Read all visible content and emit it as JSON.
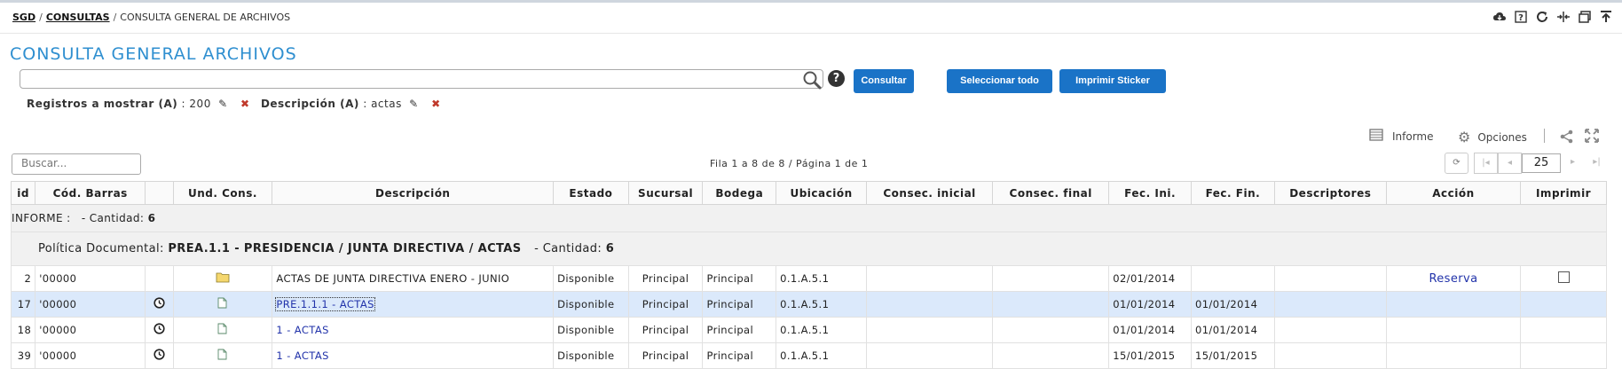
{
  "breadcrumb": {
    "root": "SGD",
    "section": "CONSULTAS",
    "current": "CONSULTA GENERAL DE ARCHIVOS",
    "separator": "/"
  },
  "top_icons": [
    "cloud-icon",
    "help-icon",
    "refresh-icon",
    "resize-icon",
    "window-icon",
    "collapse-top-icon"
  ],
  "page": {
    "title": "CONSULTA GENERAL ARCHIVOS"
  },
  "search": {
    "value": "",
    "placeholder": ""
  },
  "buttons": {
    "consultar": "Consultar",
    "select_all": "Seleccionar todo",
    "print_sticker": "Imprimir Sticker"
  },
  "filters": [
    {
      "label": "Registros a mostrar (A)",
      "separator": ":",
      "value": "200"
    },
    {
      "label": "Descripción (A)",
      "separator": ":",
      "value": "actas"
    }
  ],
  "toolbar": {
    "report": "Informe",
    "options": "Opciones"
  },
  "grid": {
    "search_placeholder": "Buscar...",
    "pager_info": "Fila 1 a 8 de 8 / Página 1 de 1",
    "page_size": "25",
    "columns": [
      "id",
      "Cód. Barras",
      "",
      "Und. Cons.",
      "Descripción",
      "Estado",
      "Sucursal",
      "Bodega",
      "Ubicación",
      "Consec. inicial",
      "Consec. final",
      "Fec. Ini.",
      "Fec. Fin.",
      "Descriptores",
      "Acción",
      "Imprimir"
    ],
    "group1": {
      "label": "INFORME :",
      "count_label": "- Cantidad:",
      "count": "6"
    },
    "group2": {
      "label": "Política Documental:",
      "value": "PREA.1.1 - PRESIDENCIA / JUNTA DIRECTIVA / ACTAS",
      "count_label": "- Cantidad:",
      "count": "6"
    },
    "rows": [
      {
        "id": "2",
        "barcode": "'00000",
        "icon": "folder-icon",
        "unit_icon": "folder-icon",
        "description": "ACTAS DE JUNTA DIRECTIVA ENERO - JUNIO",
        "estado": "Disponible",
        "sucursal": "Principal",
        "bodega": "Principal",
        "ubicacion": "0.1.A.5.1",
        "fec_ini": "02/01/2014",
        "fec_fin": "",
        "accion": "Reserva"
      },
      {
        "id": "17",
        "barcode": "'00000",
        "icon": "clock-icon",
        "unit_icon": "document-icon",
        "description": "PRE.1.1.1 - ACTAS",
        "estado": "Disponible",
        "sucursal": "Principal",
        "bodega": "Principal",
        "ubicacion": "0.1.A.5.1",
        "fec_ini": "01/01/2014",
        "fec_fin": "01/01/2014",
        "accion": ""
      },
      {
        "id": "18",
        "barcode": "'00000",
        "icon": "clock-icon",
        "unit_icon": "document-icon",
        "description": "1 - ACTAS",
        "estado": "Disponible",
        "sucursal": "Principal",
        "bodega": "Principal",
        "ubicacion": "0.1.A.5.1",
        "fec_ini": "01/01/2014",
        "fec_fin": "01/01/2014",
        "accion": ""
      },
      {
        "id": "39",
        "barcode": "'00000",
        "icon": "clock-icon",
        "unit_icon": "document-icon",
        "description": "1 - ACTAS",
        "estado": "Disponible",
        "sucursal": "Principal",
        "bodega": "Principal",
        "ubicacion": "0.1.A.5.1",
        "fec_ini": "15/01/2015",
        "fec_fin": "15/01/2015",
        "accion": ""
      }
    ]
  }
}
